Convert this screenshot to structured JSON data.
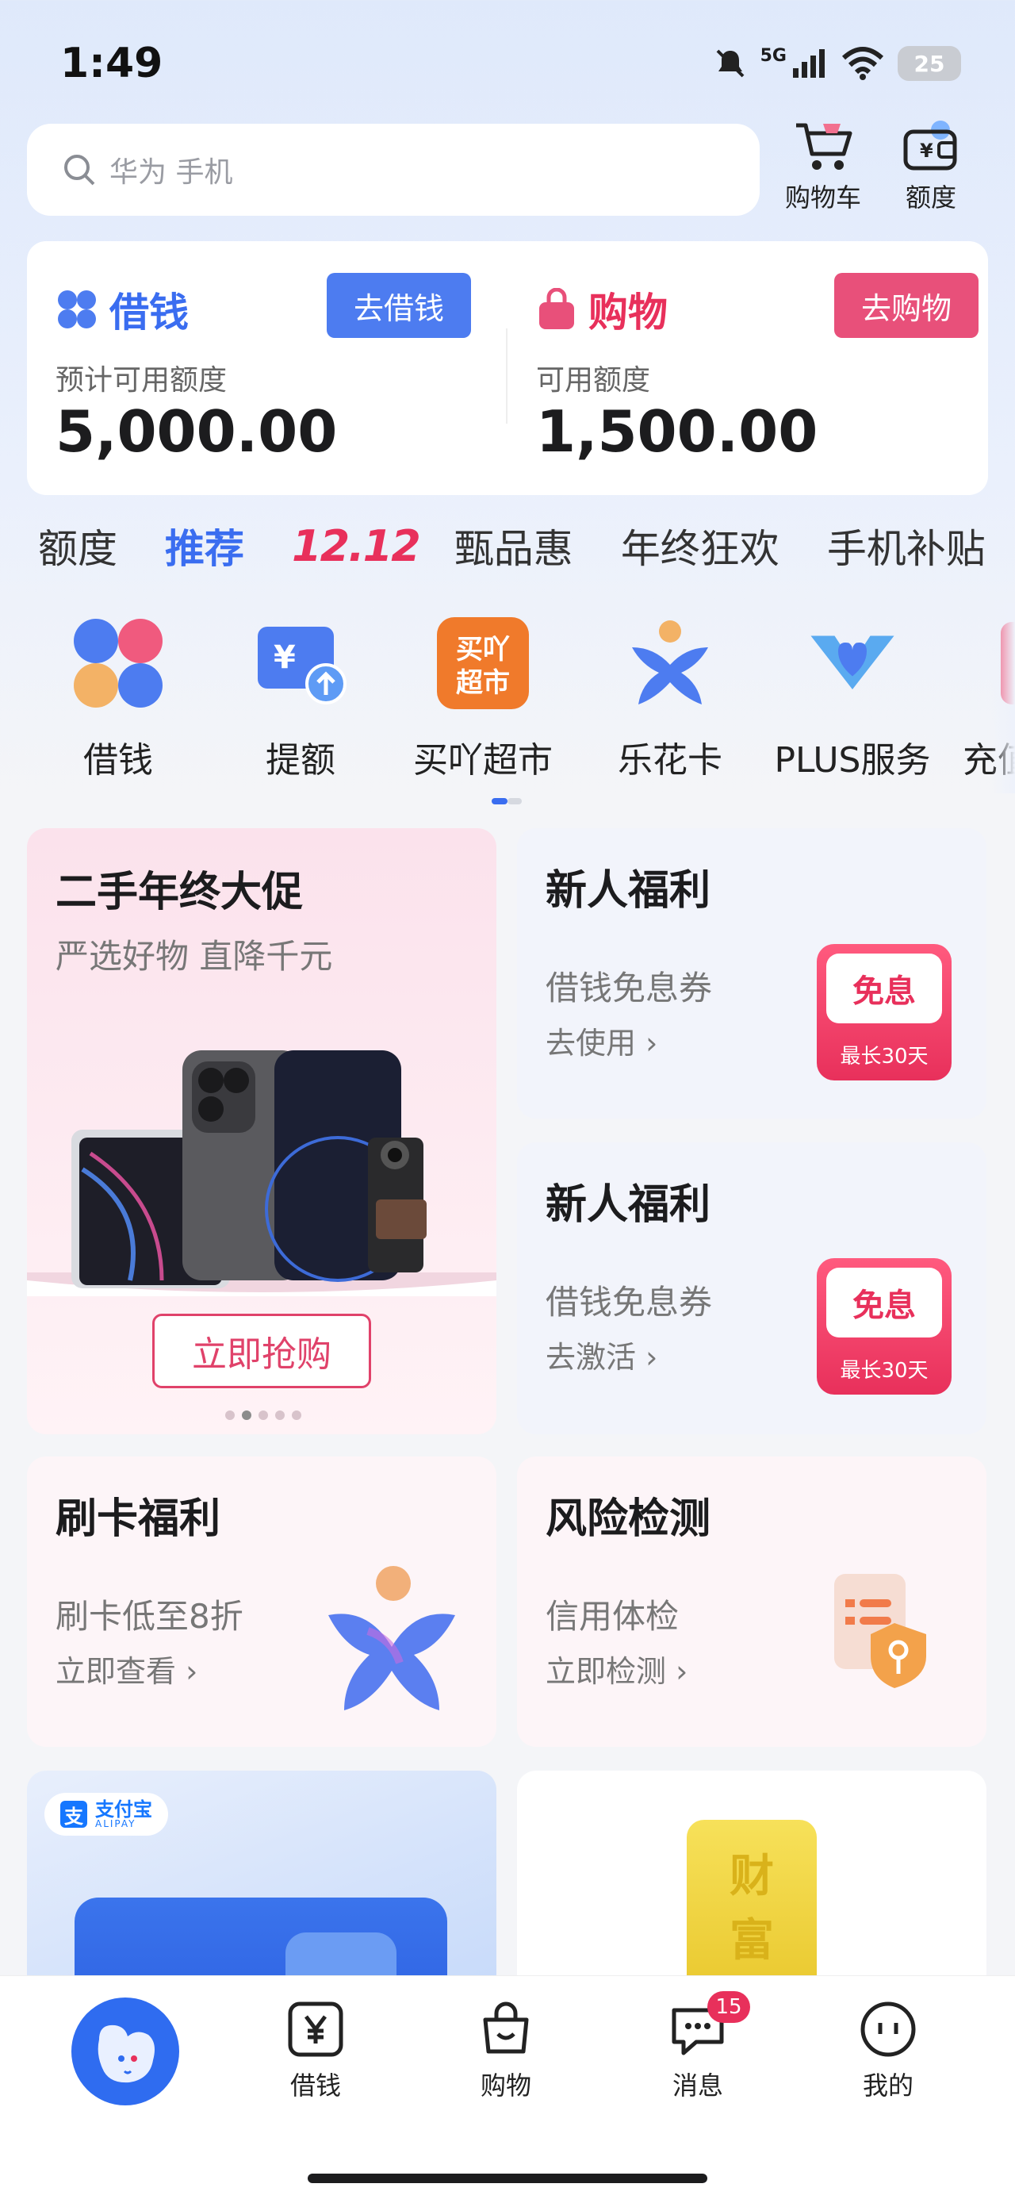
{
  "status": {
    "time": "1:49",
    "battery": "25",
    "network": "5G"
  },
  "search": {
    "placeholder": "华为 手机"
  },
  "top_actions": {
    "cart": "购物车",
    "quota": "额度"
  },
  "credit": {
    "borrow": {
      "title": "借钱",
      "button": "去借钱",
      "sub": "预计可用额度",
      "amount": "5,000.00"
    },
    "shop": {
      "title": "购物",
      "button": "去购物",
      "sub": "可用额度",
      "amount": "1,500.00"
    }
  },
  "tabs": [
    "额度",
    "推荐",
    "12.12",
    "甄品惠",
    "年终狂欢",
    "手机补贴"
  ],
  "quick": [
    "借钱",
    "提额",
    "买吖超市",
    "乐花卡",
    "PLUS服务",
    "充值"
  ],
  "quick_icon_text": {
    "market_line1": "买吖",
    "market_line2": "超市"
  },
  "promo": {
    "title": "二手年终大促",
    "sub": "严选好物 直降千元",
    "button": "立即抢购"
  },
  "welfare1": {
    "title": "新人福利",
    "sub": "借钱免息券",
    "link": "去使用",
    "badge": "免息",
    "badge_foot": "最长30天"
  },
  "welfare2": {
    "title": "新人福利",
    "sub": "借钱免息券",
    "link": "去激活",
    "badge": "免息",
    "badge_foot": "最长30天"
  },
  "card_benefit": {
    "title": "刷卡福利",
    "sub": "刷卡低至8折",
    "link": "立即查看"
  },
  "risk": {
    "title": "风险检测",
    "sub": "信用体检",
    "link": "立即检测"
  },
  "alipay": {
    "brand": "支付宝",
    "brand_sub": "ALIPAY"
  },
  "gold": {
    "text1": "财",
    "text2": "富"
  },
  "nav": {
    "borrow": "借钱",
    "shop": "购物",
    "msg": "消息",
    "msg_badge": "15",
    "me": "我的"
  },
  "colors": {
    "accent": "#3a6df0",
    "pink": "#e8305b",
    "blue_btn": "#4d7cf0",
    "pink_btn": "#e8507a"
  }
}
